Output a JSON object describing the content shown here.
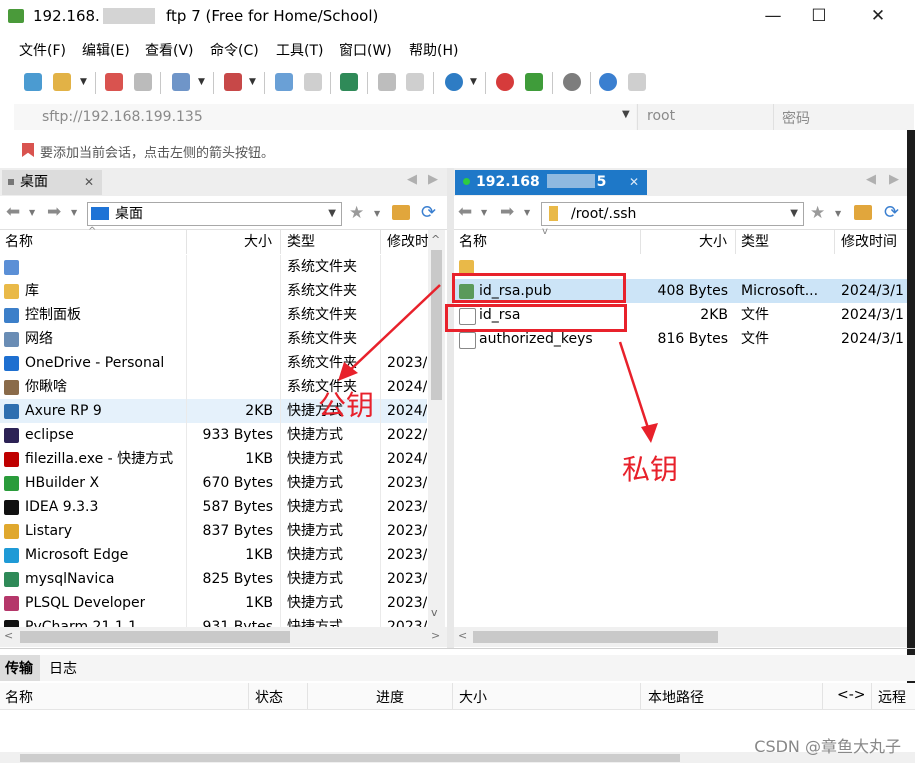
{
  "window": {
    "title_prefix": "192.168.",
    "title_suffix": "ftp 7 (Free for Home/School)",
    "minimize": "—",
    "maximize": "☐",
    "close": "✕"
  },
  "menu": [
    "文件(F)",
    "编辑(E)",
    "查看(V)",
    "命令(C)",
    "工具(T)",
    "窗口(W)",
    "帮助(H)"
  ],
  "address": {
    "url": "sftp://192.168.199.135",
    "user_placeholder": "root",
    "password_placeholder": "密码"
  },
  "hint": "要添加当前会话，点击左侧的箭头按钮。",
  "left_pane": {
    "tab": "桌面",
    "path": "桌面",
    "columns": [
      "名称",
      "大小",
      "类型",
      "修改时"
    ],
    "rows": [
      {
        "name": "",
        "size": "",
        "type": "系统文件夹",
        "date": "",
        "icon": "computer-icon",
        "color": "#5b8fd6"
      },
      {
        "name": "库",
        "size": "",
        "type": "系统文件夹",
        "date": "",
        "icon": "library-icon",
        "color": "#e9b948"
      },
      {
        "name": "控制面板",
        "size": "",
        "type": "系统文件夹",
        "date": "",
        "icon": "control-panel-icon",
        "color": "#3c7fc9"
      },
      {
        "name": "网络",
        "size": "",
        "type": "系统文件夹",
        "date": "",
        "icon": "network-icon",
        "color": "#6a8db5"
      },
      {
        "name": "OneDrive - Personal",
        "size": "",
        "type": "系统文件夹",
        "date": "2023/",
        "icon": "onedrive-icon",
        "color": "#1e6fd0"
      },
      {
        "name": "你瞅啥",
        "size": "",
        "type": "系统文件夹",
        "date": "2024/",
        "icon": "user-icon",
        "color": "#8a6b4a"
      },
      {
        "name": "Axure RP 9",
        "size": "2KB",
        "type": "快捷方式",
        "date": "2024/",
        "icon": "axure-icon",
        "color": "#2f6fb0"
      },
      {
        "name": "eclipse",
        "size": "933 Bytes",
        "type": "快捷方式",
        "date": "2022/",
        "icon": "eclipse-icon",
        "color": "#2c2255"
      },
      {
        "name": "filezilla.exe - 快捷方式",
        "size": "1KB",
        "type": "快捷方式",
        "date": "2024/",
        "icon": "filezilla-icon",
        "color": "#bf0000"
      },
      {
        "name": "HBuilder X",
        "size": "670 Bytes",
        "type": "快捷方式",
        "date": "2023/",
        "icon": "hbuilder-icon",
        "color": "#2a9c3b"
      },
      {
        "name": "IDEA 9.3.3",
        "size": "587 Bytes",
        "type": "快捷方式",
        "date": "2023/",
        "icon": "idea-icon",
        "color": "#111111"
      },
      {
        "name": "Listary",
        "size": "837 Bytes",
        "type": "快捷方式",
        "date": "2023/",
        "icon": "listary-icon",
        "color": "#e0a82e"
      },
      {
        "name": "Microsoft Edge",
        "size": "1KB",
        "type": "快捷方式",
        "date": "2023/",
        "icon": "edge-icon",
        "color": "#1f9ad6"
      },
      {
        "name": "mysqlNavica",
        "size": "825 Bytes",
        "type": "快捷方式",
        "date": "2023/",
        "icon": "navicat-icon",
        "color": "#2f8a58"
      },
      {
        "name": "PLSQL Developer",
        "size": "1KB",
        "type": "快捷方式",
        "date": "2023/",
        "icon": "plsql-icon",
        "color": "#b5376a"
      },
      {
        "name": "PyCharm 21.1.1",
        "size": "931 Bytes",
        "type": "快捷方式",
        "date": "2023/",
        "icon": "pycharm-icon",
        "color": "#111111"
      }
    ]
  },
  "right_pane": {
    "tab": "192.168",
    "tab_suffix": "5",
    "path": "/root/.ssh",
    "columns": [
      "名称",
      "大小",
      "类型",
      "修改时间"
    ],
    "rows": [
      {
        "name": "",
        "size": "",
        "type": "",
        "date": "",
        "icon": "folder-up-icon",
        "color": "#e9b948"
      },
      {
        "name": "id_rsa.pub",
        "size": "408 Bytes",
        "type": "Microsoft...",
        "date": "2024/3/1",
        "icon": "pub-file-icon",
        "color": "#5a9a5a"
      },
      {
        "name": "id_rsa",
        "size": "2KB",
        "type": "文件",
        "date": "2024/3/1",
        "icon": "file-icon",
        "color": "#ffffff"
      },
      {
        "name": "authorized_keys",
        "size": "816 Bytes",
        "type": "文件",
        "date": "2024/3/1",
        "icon": "file-icon",
        "color": "#ffffff"
      }
    ]
  },
  "annotations": {
    "public_key": "公钥",
    "private_key": "私钥"
  },
  "bottom": {
    "tabs": [
      "传输",
      "日志"
    ],
    "columns": [
      "名称",
      "状态",
      "进度",
      "大小",
      "本地路径",
      "<->",
      "远程"
    ]
  },
  "watermark": "CSDN @章鱼大丸子"
}
